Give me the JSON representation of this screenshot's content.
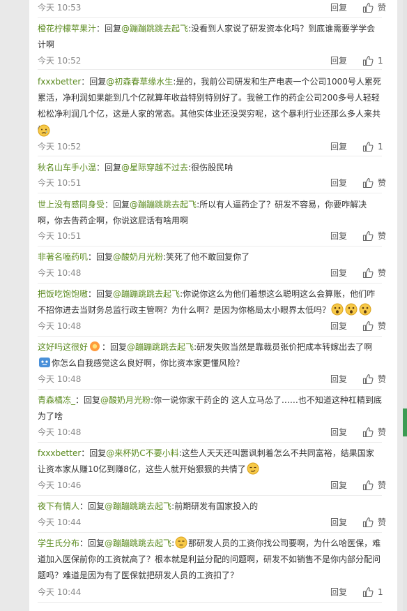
{
  "ui": {
    "reply_label": "回复",
    "like_label": "赞",
    "reply_prefix": "回复",
    "at": "@"
  },
  "comments": [
    {
      "user": "",
      "target": "",
      "text": "",
      "time": "今天 10:53",
      "likes": "赞"
    },
    {
      "user": "橙花柠檬苹果汁",
      "target": "蹦蹦跳跳去起飞",
      "text": "没看到人家说了研发资本化吗？到底谁需要学学会计啊",
      "time": "今天 10:52",
      "likes": "1"
    },
    {
      "user": "fxxxbetter",
      "target": "初森春草缘水生",
      "text": "是的，我前公司研发和生产电表一个公司1000号人累死累活，净利润如果能到几个亿就算年收益特别特别好了。我爸工作的药企公司200多号人轻轻松松净利润几个亿，这是人家的常态。其他实体业还没哭穷呢，这个暴利行业还那么多人来共情",
      "time": "今天 10:52",
      "likes": "1"
    },
    {
      "user": "秋名山车手小温",
      "target": "星际穿越不过去",
      "text": "很伤股民呐",
      "time": "今天 10:51",
      "likes": "赞"
    },
    {
      "user": "世上没有感同身受",
      "target": "蹦蹦跳跳去起飞",
      "text": "所以有人逼药企了？研发不容易，你要咋解决啊，你去告药企啊，你说这屁话有啥用啊",
      "time": "今天 10:51",
      "likes": "赞"
    },
    {
      "user": "非著名嗑药叽",
      "target": "酸奶月光粉",
      "text": "笑死了他不敢回复你了",
      "time": "今天 10:48",
      "likes": "赞"
    },
    {
      "user": "把饭吃饱饱嗷",
      "target": "蹦蹦跳跳去起飞",
      "text": "你说你这么为他们着想这么聪明这么会算账，他们咋不招你进去当财务总监行政主管啊？为什么啊？是因为你格局太小眼界太低吗？",
      "time": "今天 10:48",
      "likes": "赞"
    },
    {
      "user": "这好吗这很好",
      "target": "蹦蹦跳跳去起飞",
      "text": "研发失败当然是靠裁员张价把成本转嫁出去了啊",
      "text2": "你怎么自我感觉这么良好啊，你比资本家更懂风险？",
      "time": "今天 10:48",
      "likes": "赞"
    },
    {
      "user": "青森橘冻_",
      "target": "酸奶月光粉",
      "text": "你一说你家干药企的 这人立马怂了……也不知道这种杠精到底为了啥",
      "time": "今天 10:48",
      "likes": "赞"
    },
    {
      "user": "fxxxbetter",
      "target": "来杯奶C不要小料",
      "text": "这些人天天还叫嚣讽刺着怎么不共同富裕，结果国家让资本家从赚10亿到赚8亿，这些人就开始狠狠的共情了",
      "time": "今天 10:46",
      "likes": "赞"
    },
    {
      "user": "夜下有情人",
      "target": "蹦蹦跳跳去起飞",
      "text": "前期研发有国家投入的",
      "time": "今天 10:44",
      "likes": "赞"
    },
    {
      "user": "学生氏分布",
      "target": "蹦蹦跳跳去起飞",
      "text": "那研发人员的工资你找公司要啊，为什么哈医保，难道加入医保前你的工资就高了？根本就是利益分配的问题啊，研发不如销售不是你内部分配问题吗？难道是因为有了医保就把研发人员的工资扣了？",
      "time": "今天 10:44",
      "likes": "1"
    }
  ],
  "colors": {
    "username": "#5a8a1e",
    "time": "#888888",
    "text": "#333333",
    "scroll_accent": "#3c9b53"
  }
}
